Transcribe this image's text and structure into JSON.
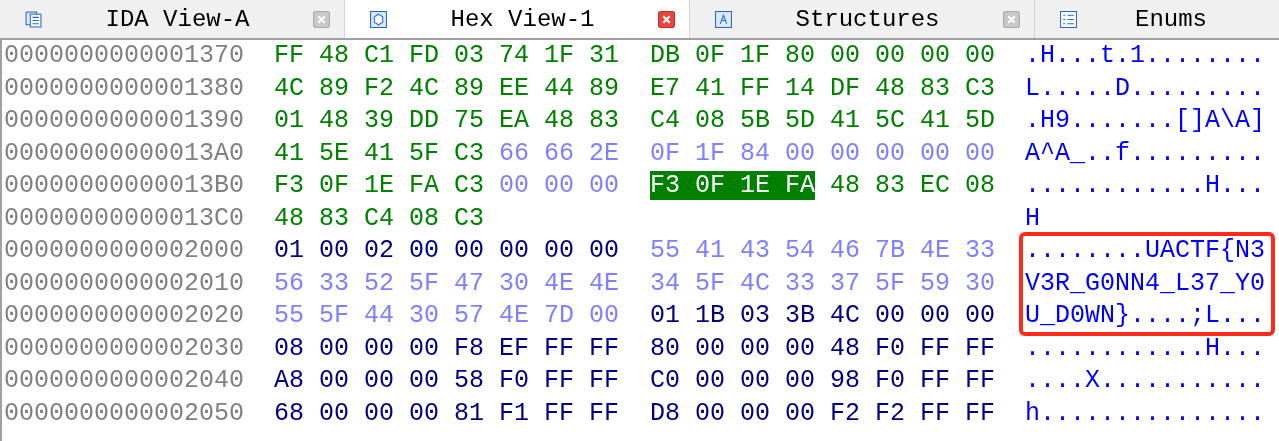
{
  "tabs": [
    {
      "label": "IDA View-A",
      "selected": false,
      "closable": true
    },
    {
      "label": "Hex View-1",
      "selected": true,
      "closable": true
    },
    {
      "label": "Structures",
      "selected": false,
      "closable": true
    },
    {
      "label": "Enums",
      "selected": false,
      "closable": false
    }
  ],
  "rows": [
    {
      "address": "0000000000001370",
      "groups": [
        [
          {
            "kind": "code",
            "selected": false,
            "bytes": "FF 48 C1 FD 03 74 1F 31"
          }
        ],
        [
          {
            "kind": "code",
            "selected": false,
            "bytes": "DB 0F 1F 80 00 00 00 00"
          }
        ]
      ],
      "ascii": ".H...t.1........",
      "boxed": false
    },
    {
      "address": "0000000000001380",
      "groups": [
        [
          {
            "kind": "code",
            "selected": false,
            "bytes": "4C 89 F2 4C 89 EE 44 89"
          }
        ],
        [
          {
            "kind": "code",
            "selected": false,
            "bytes": "E7 41 FF 14 DF 48 83 C3"
          }
        ]
      ],
      "ascii": "L.....D.........",
      "boxed": false
    },
    {
      "address": "0000000000001390",
      "groups": [
        [
          {
            "kind": "code",
            "selected": false,
            "bytes": "01 48 39 DD 75 EA 48 83"
          }
        ],
        [
          {
            "kind": "code",
            "selected": false,
            "bytes": "C4 08 5B 5D 41 5C 41 5D"
          }
        ]
      ],
      "ascii": ".H9.......[]A\\A]",
      "boxed": false
    },
    {
      "address": "00000000000013A0",
      "groups": [
        [
          {
            "kind": "code",
            "selected": false,
            "bytes": "41 5E 41 5F C3"
          },
          {
            "kind": "unexplored",
            "selected": false,
            "bytes": "66 66 2E"
          }
        ],
        [
          {
            "kind": "unexplored",
            "selected": false,
            "bytes": "0F 1F 84 00 00 00 00 00"
          }
        ]
      ],
      "ascii": "A^A_..f.........",
      "boxed": false
    },
    {
      "address": "00000000000013B0",
      "groups": [
        [
          {
            "kind": "code",
            "selected": false,
            "bytes": "F3 0F 1E FA C3"
          },
          {
            "kind": "unexplored",
            "selected": false,
            "bytes": "00 00 00"
          }
        ],
        [
          {
            "kind": "code",
            "selected": true,
            "bytes": "F3 0F 1E FA"
          },
          {
            "kind": "code",
            "selected": false,
            "bytes": "48 83 EC 08"
          }
        ]
      ],
      "ascii": "............H...",
      "boxed": false
    },
    {
      "address": "00000000000013C0",
      "groups": [
        [
          {
            "kind": "code",
            "selected": false,
            "bytes": "48 83 C4 08 C3"
          }
        ]
      ],
      "ascii": "H",
      "boxed": false
    },
    {
      "address": "0000000000002000",
      "groups": [
        [
          {
            "kind": "data",
            "selected": false,
            "bytes": "01 00 02 00 00 00 00 00"
          }
        ],
        [
          {
            "kind": "unexplored",
            "selected": false,
            "bytes": "55 41 43 54 46 7B 4E 33"
          }
        ]
      ],
      "ascii": "........UACTF{N3",
      "boxed": true
    },
    {
      "address": "0000000000002010",
      "groups": [
        [
          {
            "kind": "unexplored",
            "selected": false,
            "bytes": "56 33 52 5F 47 30 4E 4E"
          }
        ],
        [
          {
            "kind": "unexplored",
            "selected": false,
            "bytes": "34 5F 4C 33 37 5F 59 30"
          }
        ]
      ],
      "ascii": "V3R_G0NN4_L37_Y0",
      "boxed": true
    },
    {
      "address": "0000000000002020",
      "groups": [
        [
          {
            "kind": "unexplored",
            "selected": false,
            "bytes": "55 5F 44 30 57 4E 7D 00"
          }
        ],
        [
          {
            "kind": "data",
            "selected": false,
            "bytes": "01 1B 03 3B 4C 00 00 00"
          }
        ]
      ],
      "ascii": "U_D0WN}....;L...",
      "boxed": true
    },
    {
      "address": "0000000000002030",
      "groups": [
        [
          {
            "kind": "data",
            "selected": false,
            "bytes": "08 00 00 00 F8 EF FF FF"
          }
        ],
        [
          {
            "kind": "data",
            "selected": false,
            "bytes": "80 00 00 00 48 F0 FF FF"
          }
        ]
      ],
      "ascii": "............H...",
      "boxed": false
    },
    {
      "address": "0000000000002040",
      "groups": [
        [
          {
            "kind": "data",
            "selected": false,
            "bytes": "A8 00 00 00 58 F0 FF FF"
          }
        ],
        [
          {
            "kind": "data",
            "selected": false,
            "bytes": "C0 00 00 00 98 F0 FF FF"
          }
        ]
      ],
      "ascii": "....X...........",
      "boxed": false
    },
    {
      "address": "0000000000002050",
      "groups": [
        [
          {
            "kind": "data",
            "selected": false,
            "bytes": "68 00 00 00 81 F1 FF FF"
          }
        ],
        [
          {
            "kind": "data",
            "selected": false,
            "bytes": "D8 00 00 00 F2 F2 FF FF"
          }
        ]
      ],
      "ascii": "h...............",
      "boxed": false
    }
  ]
}
